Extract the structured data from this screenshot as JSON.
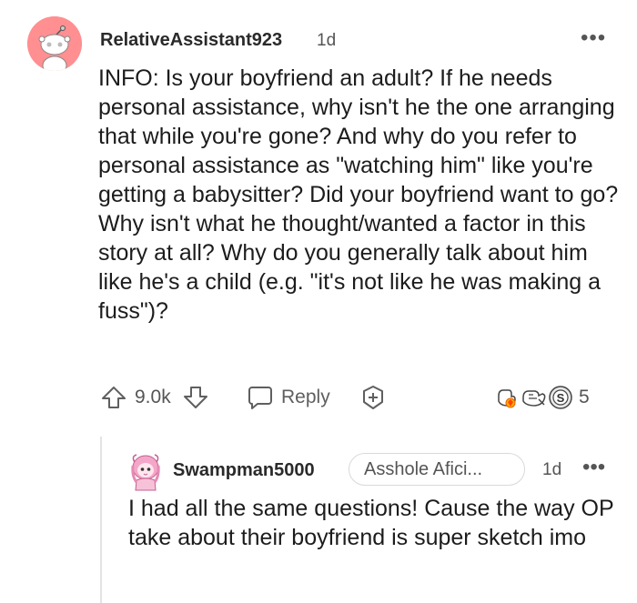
{
  "comment": {
    "username": "RelativeAssistant923",
    "timestamp": "1d",
    "more_label": "•••",
    "body": "INFO: Is your boyfriend an adult? If he needs personal assistance, why isn't he the one arranging that while you're gone? And why do you refer to personal assistance as \"watching him\" like you're getting a babysitter? Did your boyfriend want to go? Why isn't what he thought/wanted a factor in this story at all? Why do you generally talk about him like he's a child (e.g. \"it's not like he was making a fuss\")?",
    "actions": {
      "upvote_icon": "upvote-arrow-icon",
      "vote_count": "9.0k",
      "downvote_icon": "downvote-arrow-icon",
      "reply_icon": "speech-bubble-icon",
      "reply_label": "Reply",
      "award_icon": "plus-award-icon"
    },
    "awards": {
      "icons": [
        "wholesome-award-icon",
        "helpful-award-icon",
        "silver-award-icon"
      ],
      "count": "5"
    },
    "avatar_color": "#ff8f91"
  },
  "reply": {
    "username": "Swampman5000",
    "flair": "Asshole Afici...",
    "timestamp": "1d",
    "more_label": "•••",
    "body": "I had all the same questions! Cause the way OP take about their boyfriend is super sketch imo",
    "avatar_color": "#f4a6c8"
  }
}
